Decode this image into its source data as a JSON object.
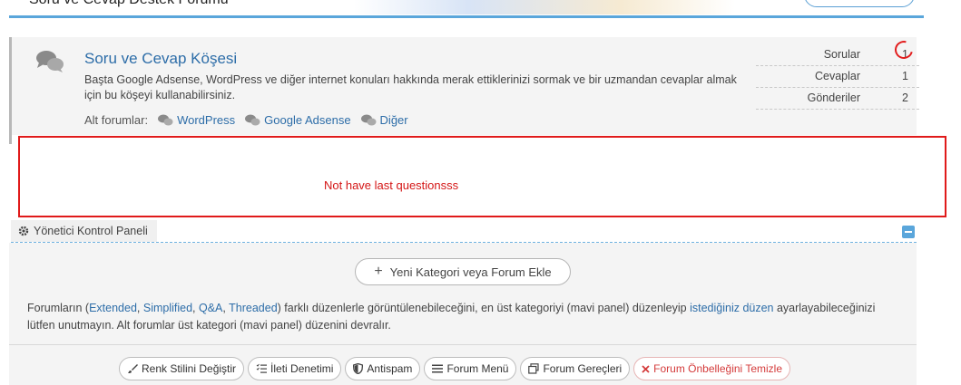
{
  "header": {
    "title_cut": "Soru ve Cevap Destek Forumu"
  },
  "forum": {
    "title": "Soru ve Cevap Köşesi",
    "description": "Başta Google Adsense, WordPress ve diğer internet konuları hakkında merak ettiklerinizi sormak ve bir uzmandan cevaplar almak için bu köşeyi kullanabilirsiniz.",
    "subforums_label": "Alt forumlar:",
    "subforums": [
      "WordPress",
      "Google Adsense",
      "Diğer"
    ],
    "stats": [
      {
        "label": "Sorular",
        "value": "1"
      },
      {
        "label": "Cevaplar",
        "value": "1"
      },
      {
        "label": "Gönderiler",
        "value": "2"
      }
    ]
  },
  "annotation": {
    "text": "Not have last questionsss",
    "color": "#e01a1a"
  },
  "admin": {
    "tab_label": "Yönetici Kontrol Paneli",
    "new_button": "Yeni Kategori veya Forum Ekle",
    "desc_1": "Forumların (",
    "desc_extended": "Extended",
    "desc_c1": ", ",
    "desc_simplified": "Simplified",
    "desc_c2": ", ",
    "desc_qa": "Q&A",
    "desc_c3": ", ",
    "desc_threaded": "Threaded",
    "desc_2": ") farklı düzenlerle görüntülenebileceğini, en üst kategoriyi (mavi panel) düzenleyip ",
    "desc_link": "istediğiniz düzen",
    "desc_3": " ayarlayabileceğinizi lütfen unutmayın. Alt forumlar üst kategori (mavi panel) düzenini devralır.",
    "tools": [
      {
        "label": "Renk Stilini Değiştir",
        "icon": "brush-icon"
      },
      {
        "label": "İleti Denetimi",
        "icon": "checklist-icon"
      },
      {
        "label": "Antispam",
        "icon": "shield-icon"
      },
      {
        "label": "Forum Menü",
        "icon": "menu-icon"
      },
      {
        "label": "Forum Gereçleri",
        "icon": "window-icon"
      },
      {
        "label": "Forum Önbelleğini Temizle",
        "icon": "close-icon"
      }
    ]
  },
  "colors": {
    "link": "#2d6da8",
    "accent": "#5aa6db",
    "danger": "#d43b3b"
  }
}
